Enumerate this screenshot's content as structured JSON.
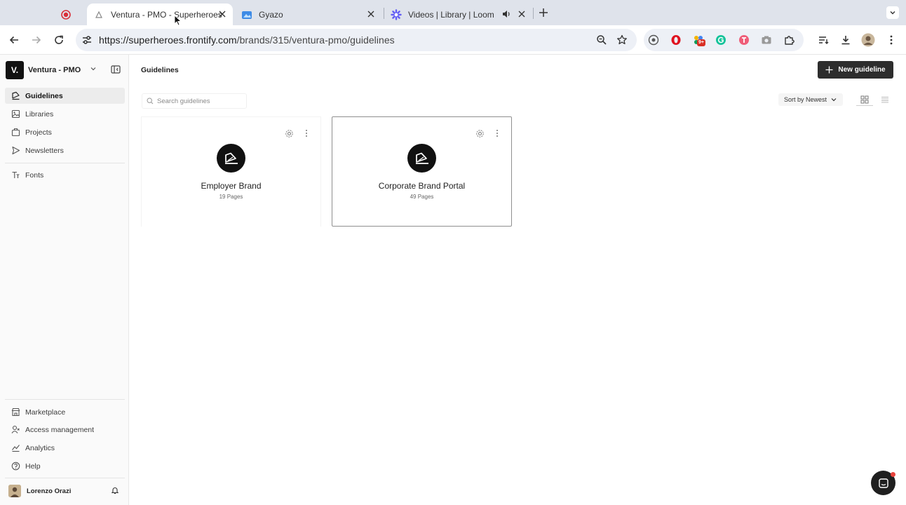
{
  "browser": {
    "tabs": [
      {
        "title": "",
        "icon": "record-icon",
        "active": false
      },
      {
        "title": "Ventura - PMO - Superheroes",
        "icon": "frontify-icon",
        "active": true
      },
      {
        "title": "Gyazo",
        "icon": "gyazo-icon",
        "active": false
      },
      {
        "title": "Videos | Library | Loom",
        "icon": "loom-icon",
        "active": false,
        "audio": true
      }
    ],
    "url_host": "https://superheroes.frontify.com",
    "url_path": "/brands/315/ventura-pmo/guidelines",
    "extension_badge": "9+"
  },
  "sidebar": {
    "brand_logo": "V.",
    "brand_name": "Ventura - PMO",
    "nav": [
      {
        "label": "Guidelines",
        "icon": "guidelines-icon",
        "active": true
      },
      {
        "label": "Libraries",
        "icon": "libraries-icon",
        "active": false
      },
      {
        "label": "Projects",
        "icon": "projects-icon",
        "active": false
      },
      {
        "label": "Newsletters",
        "icon": "newsletters-icon",
        "active": false
      },
      {
        "label": "Fonts",
        "icon": "fonts-icon",
        "active": false
      }
    ],
    "bottom_nav": [
      {
        "label": "Marketplace",
        "icon": "marketplace-icon"
      },
      {
        "label": "Access management",
        "icon": "access-icon"
      },
      {
        "label": "Analytics",
        "icon": "analytics-icon"
      },
      {
        "label": "Help",
        "icon": "help-icon"
      }
    ],
    "user_name": "Lorenzo Orazi"
  },
  "main": {
    "title": "Guidelines",
    "new_button": "New guideline",
    "search_placeholder": "Search guidelines",
    "sort_label": "Sort by Newest",
    "cards": [
      {
        "name": "Employer Brand",
        "pages": "19 Pages",
        "selected": false
      },
      {
        "name": "Corporate Brand Portal",
        "pages": "49 Pages",
        "selected": true
      }
    ]
  },
  "colors": {
    "accent_dark": "#2d2d2d",
    "sidebar_bg": "#fafafa",
    "tabbar_bg": "#dfe3eb",
    "record_red": "#d9303a"
  }
}
